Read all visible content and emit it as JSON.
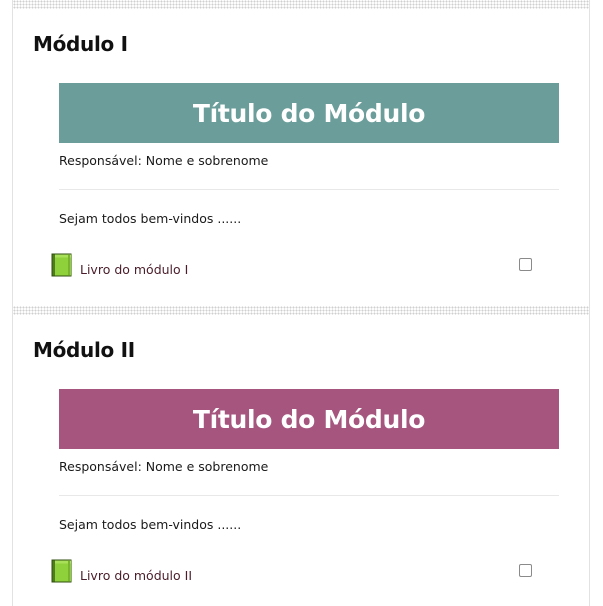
{
  "colors": {
    "module_1_banner": "#6b9e9a",
    "module_2_banner": "#a6557f",
    "link": "#4a1d2a",
    "book_icon": "#8fd13a"
  },
  "modules": [
    {
      "title": "Módulo I",
      "banner_text": "Título do Módulo",
      "responsible": "Responsável: Nome e sobrenome",
      "welcome": "Sejam todos bem-vindos ......",
      "activity": {
        "icon": "book-icon",
        "label": "Livro do módulo I",
        "completed": false
      }
    },
    {
      "title": "Módulo II",
      "banner_text": "Título do Módulo",
      "responsible": "Responsável: Nome e sobrenome",
      "welcome": "Sejam todos bem-vindos ......",
      "activity": {
        "icon": "book-icon",
        "label": "Livro do módulo II",
        "completed": false
      }
    }
  ]
}
